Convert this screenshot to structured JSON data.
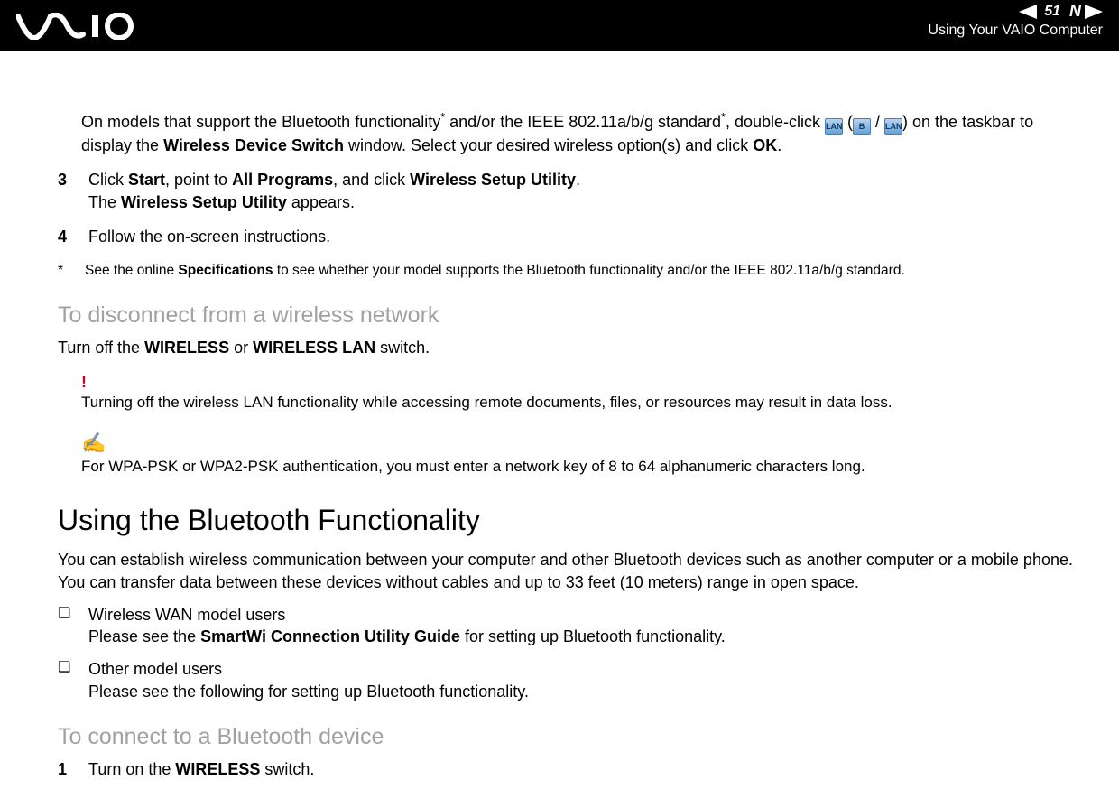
{
  "header": {
    "logo_text": "VAIO",
    "page_number": "51",
    "n_letter": "N",
    "section_label": "Using Your VAIO Computer"
  },
  "intro": {
    "text_a": "On models that support the Bluetooth functionality",
    "star1": "*",
    "text_b": " and/or the IEEE 802.11a/b/g standard",
    "star2": "*",
    "text_c": ", double-click ",
    "icon1": "LAN",
    "text_d": " (",
    "icon2": "B",
    "text_e": " / ",
    "icon3": "LAN",
    "text_f": ") on the taskbar to display the ",
    "bold1": "Wireless Device Switch",
    "text_g": " window. Select your desired wireless option(s) and click ",
    "bold2": "OK",
    "text_h": "."
  },
  "step3": {
    "num": "3",
    "l1a": "Click ",
    "l1b": "Start",
    "l1c": ", point to ",
    "l1d": "All Programs",
    "l1e": ", and click ",
    "l1f": "Wireless Setup Utility",
    "l1g": ".",
    "l2a": "The ",
    "l2b": "Wireless Setup Utility",
    "l2c": " appears."
  },
  "step4": {
    "num": "4",
    "text": "Follow the on-screen instructions."
  },
  "footnote": {
    "star": "*",
    "a": "See the online ",
    "b": "Specifications",
    "c": " to see whether your model supports the Bluetooth functionality and/or the IEEE 802.11a/b/g standard."
  },
  "disconnect": {
    "heading": "To disconnect from a wireless network",
    "text_a": "Turn off the ",
    "text_b": "WIRELESS",
    "text_c": " or ",
    "text_d": "WIRELESS LAN",
    "text_e": " switch."
  },
  "warn": {
    "bang": "!",
    "text": "Turning off the wireless LAN functionality while accessing remote documents, files, or resources may result in data loss."
  },
  "note": {
    "pencil": "✍",
    "text": "For WPA-PSK or WPA2-PSK authentication, you must enter a network key of 8 to 64 alphanumeric characters long."
  },
  "bluetooth": {
    "heading": "Using the Bluetooth Functionality",
    "para": "You can establish wireless communication between your computer and other Bluetooth devices such as another computer or a mobile phone. You can transfer data between these devices without cables and up to 33 feet (10 meters) range in open space."
  },
  "bullets": {
    "b1_l1": "Wireless WAN model users",
    "b1_l2a": "Please see the ",
    "b1_l2b": "SmartWi Connection Utility Guide",
    "b1_l2c": " for setting up Bluetooth functionality.",
    "b2_l1": "Other model users",
    "b2_l2": "Please see the following for setting up Bluetooth functionality."
  },
  "connect": {
    "heading": "To connect to a Bluetooth device",
    "step1_num": "1",
    "step1_a": "Turn on the ",
    "step1_b": "WIRELESS",
    "step1_c": " switch."
  }
}
